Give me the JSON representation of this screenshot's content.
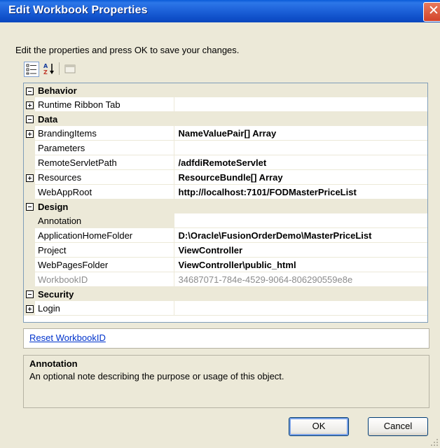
{
  "window": {
    "title": "Edit Workbook Properties",
    "close_glyph": "✕"
  },
  "instruction": "Edit the properties and press OK to save your changes.",
  "toolbar": {
    "icons": [
      "categorized-icon",
      "alphabetical-icon",
      "property-pages-icon"
    ]
  },
  "grid": {
    "categories": {
      "behavior": "Behavior",
      "data": "Data",
      "design": "Design",
      "security": "Security"
    },
    "rows": {
      "runtime_ribbon_tab": {
        "name": "Runtime Ribbon Tab",
        "value": ""
      },
      "branding_items": {
        "name": "BrandingItems",
        "value": "NameValuePair[] Array"
      },
      "parameters": {
        "name": "Parameters",
        "value": ""
      },
      "remote_servlet_path": {
        "name": "RemoteServletPath",
        "value": "/adfdiRemoteServlet"
      },
      "resources": {
        "name": "Resources",
        "value": "ResourceBundle[] Array"
      },
      "web_app_root": {
        "name": "WebAppRoot",
        "value": "http://localhost:7101/FODMasterPriceList"
      },
      "annotation": {
        "name": "Annotation",
        "value": ""
      },
      "application_home_folder": {
        "name": "ApplicationHomeFolder",
        "value": "D:\\Oracle\\FusionOrderDemo\\MasterPriceList"
      },
      "project": {
        "name": "Project",
        "value": "ViewController"
      },
      "web_pages_folder": {
        "name": "WebPagesFolder",
        "value": "ViewController\\public_html"
      },
      "workbook_id": {
        "name": "WorkbookID",
        "value": "34687071-784e-4529-9064-806290559e8e"
      },
      "login": {
        "name": "Login",
        "value": ""
      }
    }
  },
  "links": {
    "reset_workbook_id": "Reset WorkbookID"
  },
  "description": {
    "title": "Annotation",
    "text": "An optional note describing the purpose or usage of this object."
  },
  "buttons": {
    "ok": "OK",
    "cancel": "Cancel"
  },
  "colors": {
    "title_bar": "#1E63DA",
    "dialog_bg": "#ECE9D8",
    "link": "#0033CC",
    "readonly_text": "#8C8C8C"
  }
}
